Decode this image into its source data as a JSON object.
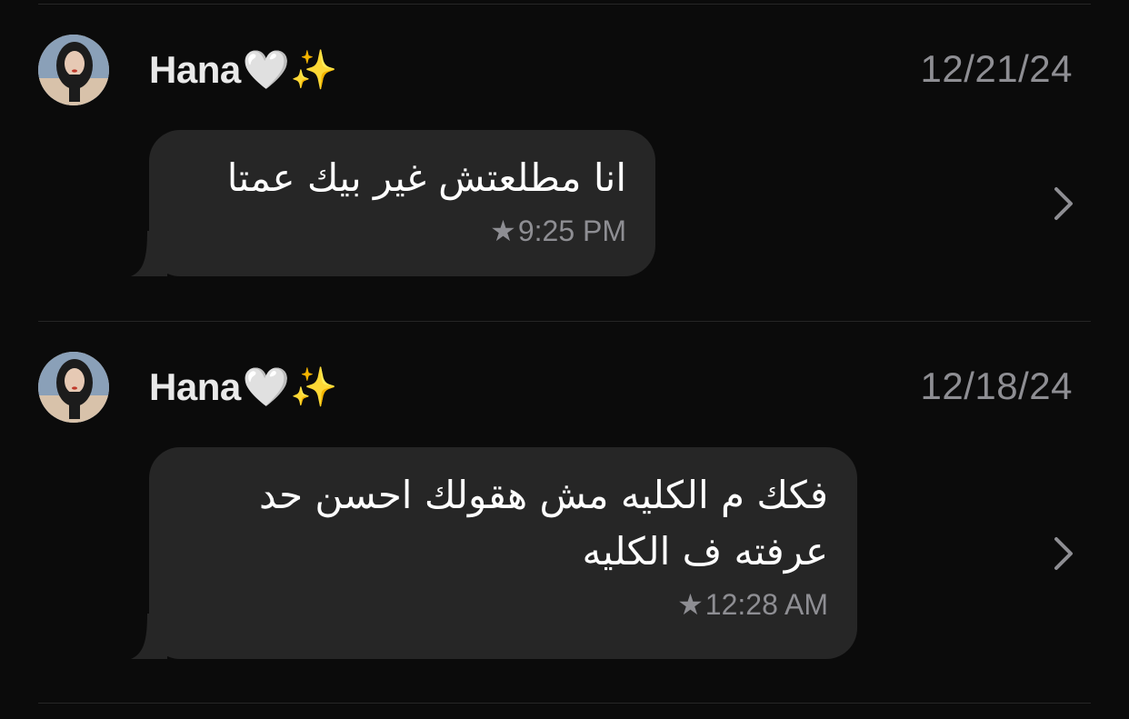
{
  "messages": [
    {
      "sender_name": "Hana",
      "sender_emoji": "🤍✨",
      "date": "12/21/24",
      "text": "انا مطلعتش غير بيك عمتا",
      "star": "★",
      "time": "9:25 PM"
    },
    {
      "sender_name": "Hana",
      "sender_emoji": "🤍✨",
      "date": "12/18/24",
      "text": "فكك م الكليه مش هقولك احسن حد عرفته ف الكليه",
      "star": "★",
      "time": "12:28 AM"
    }
  ],
  "icons": {
    "avatar": "avatar-photo",
    "star": "star-icon",
    "chevron": "chevron-right-icon"
  },
  "colors": {
    "background": "#0b0b0b",
    "bubble": "#262626",
    "secondary_text": "#8e8e93",
    "primary_text": "#ffffff",
    "divider": "#262626"
  }
}
